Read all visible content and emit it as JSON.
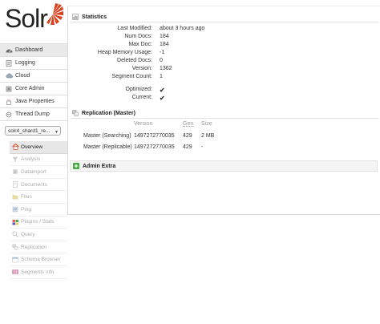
{
  "logo": {
    "text": "Solr"
  },
  "nav": [
    {
      "label": "Dashboard",
      "icon": "dashboard-icon",
      "active": true
    },
    {
      "label": "Logging",
      "icon": "logging-icon"
    },
    {
      "label": "Cloud",
      "icon": "cloud-icon"
    },
    {
      "label": "Core Admin",
      "icon": "core-admin-icon"
    },
    {
      "label": "Java Properties",
      "icon": "java-properties-icon"
    },
    {
      "label": "Thread Dump",
      "icon": "thread-dump-icon"
    }
  ],
  "core_selector": {
    "value": "solr4_shard1_re..."
  },
  "core_menu": [
    {
      "label": "Overview",
      "icon": "home-icon",
      "active": true
    },
    {
      "label": "Analysis",
      "icon": "funnel-icon"
    },
    {
      "label": "Dataimport",
      "icon": "dataimport-icon"
    },
    {
      "label": "Documents",
      "icon": "documents-icon"
    },
    {
      "label": "Files",
      "icon": "folder-icon"
    },
    {
      "label": "Ping",
      "icon": "ping-icon"
    },
    {
      "label": "Plugins / Stats",
      "icon": "plugins-icon"
    },
    {
      "label": "Query",
      "icon": "magnifier-icon"
    },
    {
      "label": "Replication",
      "icon": "replication-icon"
    },
    {
      "label": "Schema Browser",
      "icon": "schema-browser-icon"
    },
    {
      "label": "Segments info",
      "icon": "segments-icon"
    }
  ],
  "statistics": {
    "title": "Statistics",
    "rows": [
      {
        "key": "Last Modified:",
        "value": "about 3 hours ago"
      },
      {
        "key": "Num Docs:",
        "value": "184"
      },
      {
        "key": "Max Doc:",
        "value": "184"
      },
      {
        "key": "Heap Memory Usage:",
        "value": "-1"
      },
      {
        "key": "Deleted Docs:",
        "value": "0"
      },
      {
        "key": "Version:",
        "value": "1362"
      },
      {
        "key": "Segment Count:",
        "value": "1"
      }
    ],
    "flags": [
      {
        "key": "Optimized:"
      },
      {
        "key": "Current:"
      }
    ]
  },
  "replication": {
    "title": "Replication (Master)",
    "headers": {
      "version": "Version",
      "gen": "Gen",
      "size": "Size"
    },
    "rows": [
      {
        "label": "Master (Searching)",
        "version": "1497272770035",
        "gen": "429",
        "size": "2 MB"
      },
      {
        "label": "Master (Replicable)",
        "version": "1497272770035",
        "gen": "429",
        "size": "-"
      }
    ]
  },
  "admin_extra": {
    "title": "Admin Extra"
  },
  "colors": {
    "check": "#3aa03a",
    "logo_sun": "#d9411e",
    "border": "#d8d8d8"
  }
}
